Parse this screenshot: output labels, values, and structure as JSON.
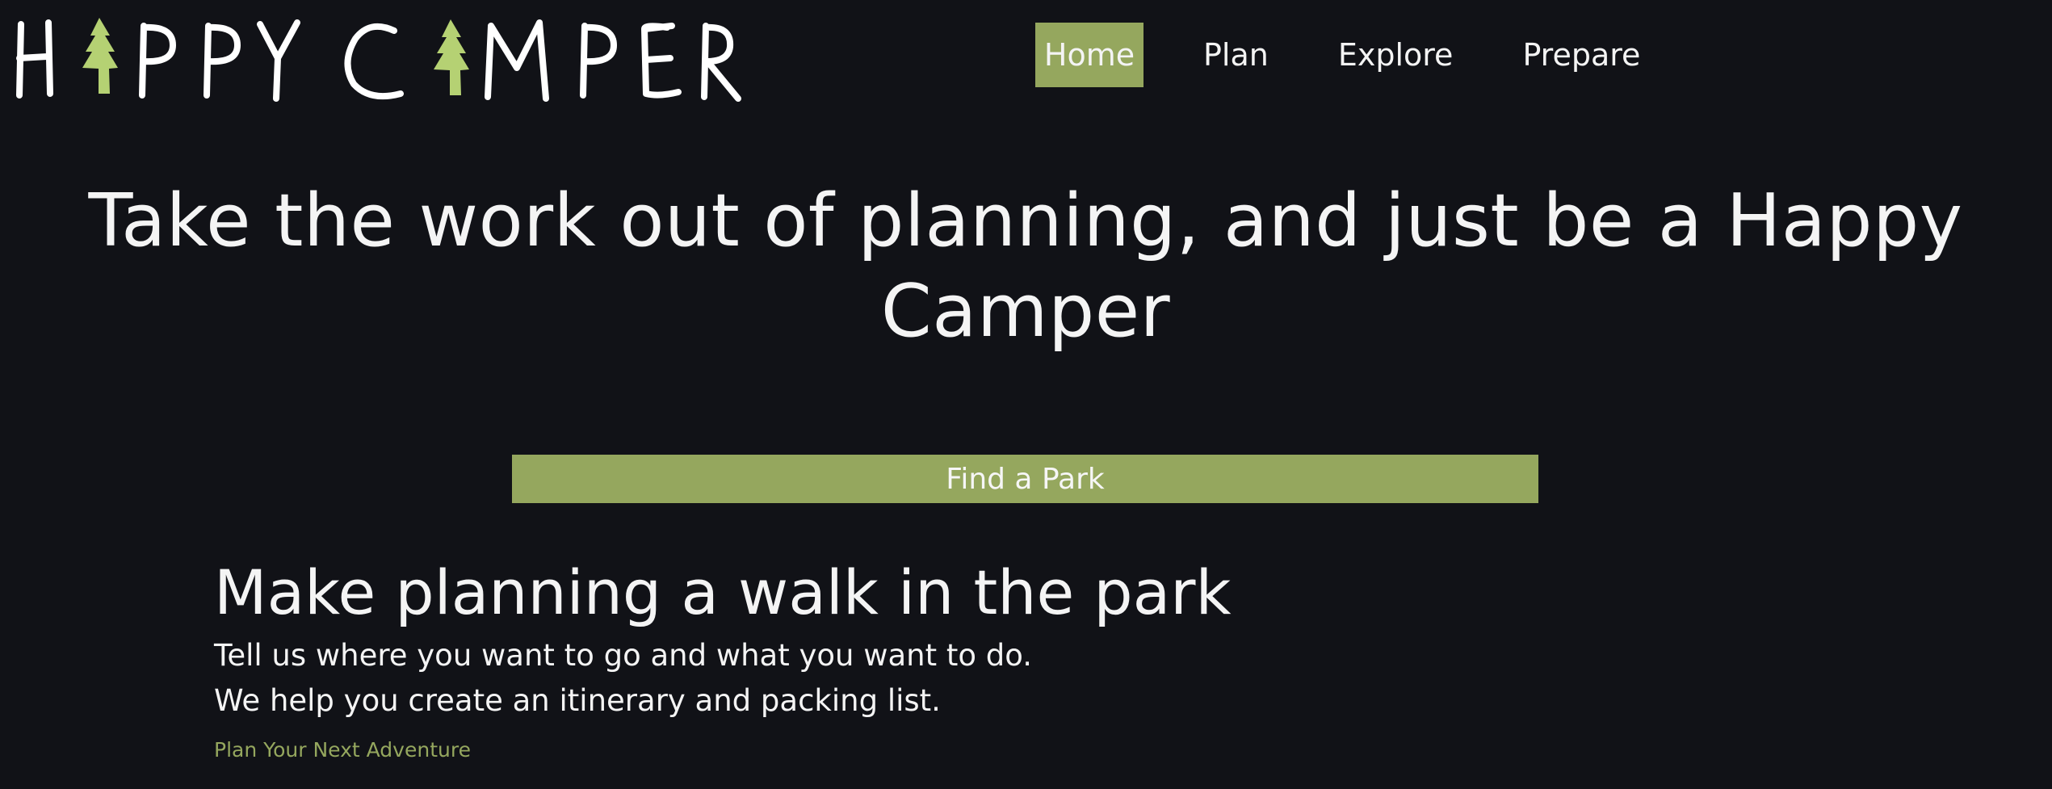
{
  "logo": {
    "text": "HAPPY CAMPER",
    "icon": "pine-tree-icon",
    "text_color": "#ffffff",
    "tree_color": "#b5d173"
  },
  "nav": {
    "items": [
      {
        "label": "Home",
        "active": true
      },
      {
        "label": "Plan",
        "active": false
      },
      {
        "label": "Explore",
        "active": false
      },
      {
        "label": "Prepare",
        "active": false
      }
    ]
  },
  "hero": {
    "title": "Take the work out of planning, and just be a Happy Camper",
    "cta_label": "Find a Park"
  },
  "section": {
    "title": "Make planning a walk in the park",
    "line1": "Tell us where you want to go and what you want to do.",
    "line2": "We help you create an itinerary and packing list.",
    "link_label": "Plan Your Next Adventure"
  },
  "colors": {
    "background": "#111217",
    "accent": "#95a75e",
    "text": "#f4f4f4"
  }
}
